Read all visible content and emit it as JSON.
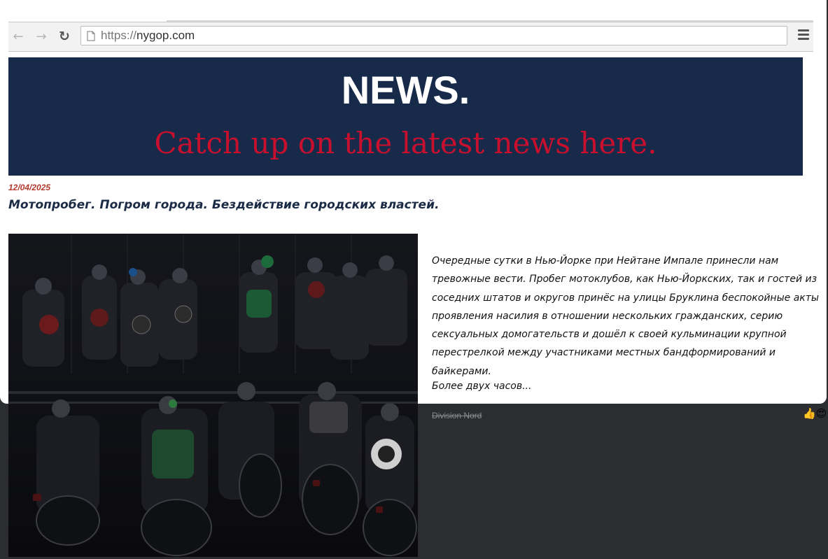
{
  "browser": {
    "url_scheme": "https://",
    "url_host": "nygop.com"
  },
  "banner": {
    "title": "NEWS.",
    "subtitle": "Catch up on the latest news here."
  },
  "article": {
    "date": "12/04/2025",
    "headline": "Мотопробег. Погром города. Бездействие городских властей.",
    "body": "Очередные сутки в Нью-Йорке при Нейтане Импале принесли нам тревожные вести. Пробег мотоклубов, как Нью-Йоркских, так и гостей из соседних штатов и округов принёс на улицы Бруклина беспокойные акты проявления насилия в отношении нескольких гражданских, серию сексуальных домогательств и дошёл к своей кульминации крупной перестрелкой между участниками местных бандформирований и байкерами.",
    "more": "Более двух часов..."
  },
  "message": {
    "author": "Division Nord",
    "reactions": "👍😍"
  },
  "colors": {
    "banner_bg": "#172a4a",
    "banner_accent": "#c8102e",
    "date": "#b03a2e",
    "headline": "#1b2b45",
    "outer_bg": "#2b2d31"
  }
}
